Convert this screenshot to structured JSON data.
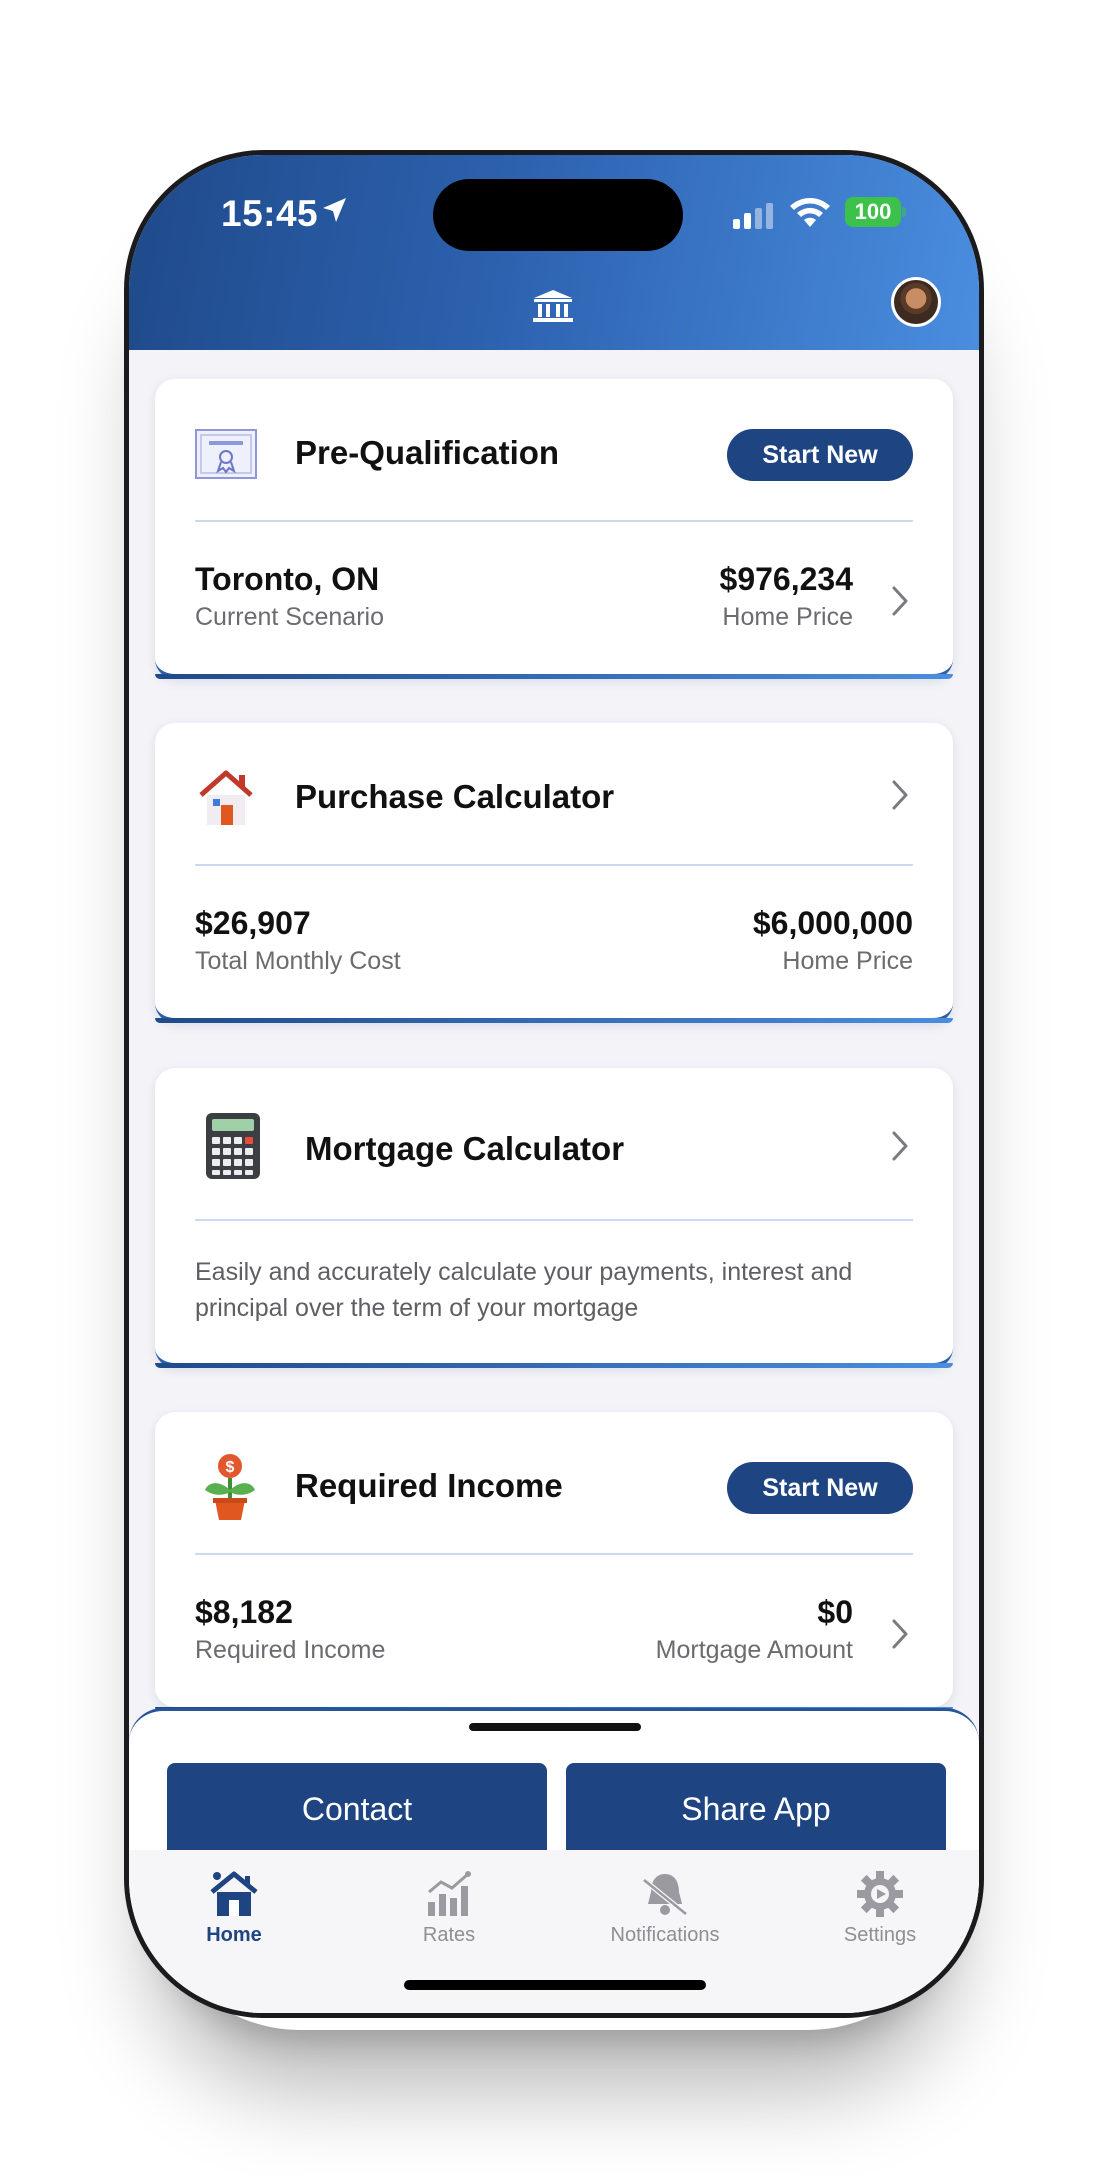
{
  "status_bar": {
    "time": "15:45",
    "battery": "100"
  },
  "prequal": {
    "title": "Pre-Qualification",
    "button": "Start New",
    "location": "Toronto, ON",
    "location_caption": "Current Scenario",
    "price": "$976,234",
    "price_caption": "Home Price"
  },
  "purchase": {
    "title": "Purchase Calculator",
    "monthly": "$26,907",
    "monthly_caption": "Total Monthly Cost",
    "price": "$6,000,000",
    "price_caption": "Home Price"
  },
  "mortgage": {
    "title": "Mortgage Calculator",
    "description": "Easily and accurately calculate your payments, interest and principal over the term of your mortgage"
  },
  "required_income": {
    "title": "Required Income",
    "button": "Start New",
    "income": "$8,182",
    "income_caption": "Required Income",
    "amount": "$0",
    "amount_caption": "Mortgage Amount"
  },
  "actions": {
    "contact": "Contact",
    "share": "Share App"
  },
  "tabs": [
    {
      "label": "Home",
      "icon": "home-icon",
      "active": true
    },
    {
      "label": "Rates",
      "icon": "chart-icon"
    },
    {
      "label": "Notifications",
      "icon": "bell-icon"
    },
    {
      "label": "Settings",
      "icon": "gear-icon"
    }
  ],
  "colors": {
    "primary": "#1e4582",
    "header_start": "#1f4a8a",
    "header_end": "#4a8ddf"
  }
}
